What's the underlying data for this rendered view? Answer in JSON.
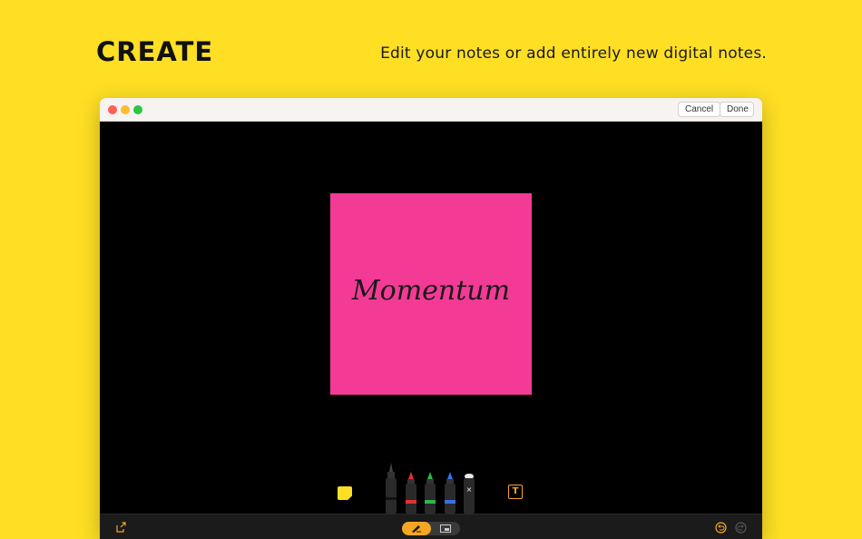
{
  "promo": {
    "headline": "CREATE",
    "tagline": "Edit your notes or add entirely new digital notes."
  },
  "window": {
    "cancel_label": "Cancel",
    "done_label": "Done"
  },
  "note": {
    "text": "Momentum",
    "color": "#F33A95"
  },
  "toolbar": {
    "tools": [
      "sticky-note-icon",
      "black-pen-icon",
      "red-pen-icon",
      "green-pen-icon",
      "blue-pen-icon",
      "eraser-icon",
      "text-tool-icon"
    ],
    "text_tool_glyph": "T",
    "pen_colors": [
      "#111111",
      "#E0322E",
      "#2DB84A",
      "#3A6FE8"
    ],
    "eraser_glyph": "×"
  },
  "bottombar": {
    "mode_selected": "draw",
    "accent": "#F5A623"
  },
  "colors": {
    "background": "#FEDF24",
    "canvas": "#000000"
  }
}
